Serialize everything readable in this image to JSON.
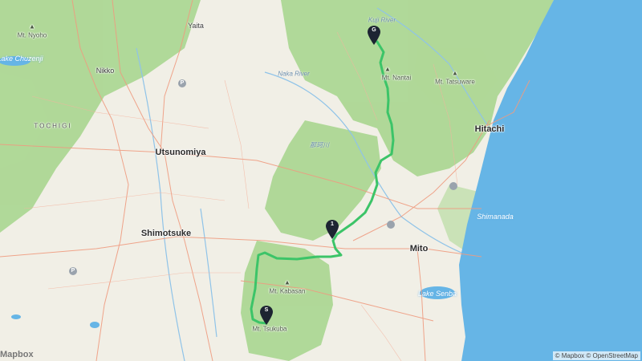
{
  "map": {
    "cities": [
      "Utsunomiya",
      "Shimotsuke",
      "Mito",
      "Hitachi"
    ],
    "towns": [
      "Nikko",
      "Yaita"
    ],
    "mountains": [
      "Mt. Nyoho",
      "Mt. Nantai",
      "Mt. Tatsuware",
      "Mt. Kabasan",
      "Mt. Tsukuba"
    ],
    "regions": [
      "TOCHIGI"
    ],
    "water_labels": [
      "Lake Chuzenji",
      "Shimanada",
      "Lake Senba"
    ],
    "rivers": [
      "Kuji River",
      "Naka River",
      "那珂川"
    ],
    "markers": {
      "start": "S",
      "waypoint": "1",
      "goal": "G"
    },
    "poi_symbol": "P",
    "logo": "Mapbox",
    "attribution": "© Mapbox © OpenStreetMap"
  },
  "colors": {
    "route": "#3cc468",
    "forest": "#a5d58b",
    "sea": "#66b5e6",
    "land": "#f1efe6",
    "road": "#ef9b80",
    "marker": "#1d2432"
  }
}
